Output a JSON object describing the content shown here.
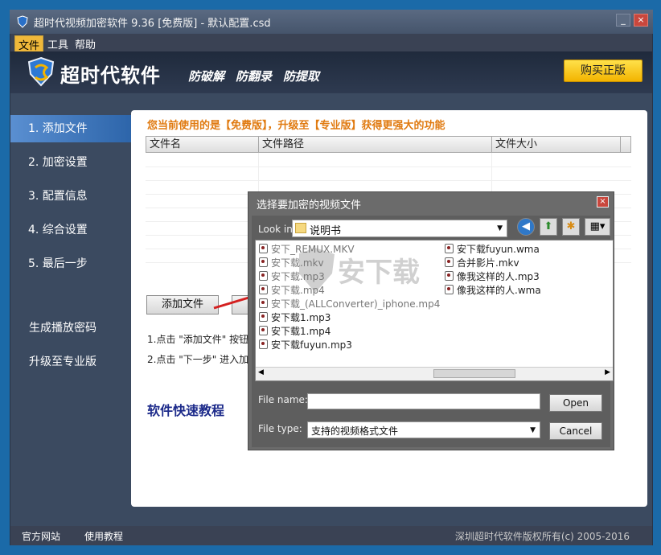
{
  "window": {
    "title": "超时代视频加密软件 9.36 [免费版] - 默认配置.csd",
    "minimize": "_",
    "close": "×"
  },
  "menu": [
    "文件",
    "工具",
    "帮助"
  ],
  "banner": {
    "brand": "超时代软件",
    "slogans": [
      "防破解",
      "防翻录",
      "防提取"
    ],
    "buy_label": "购买正版",
    "buy_color": "#f3b400"
  },
  "sidebar": {
    "steps": [
      "1. 添加文件",
      "2. 加密设置",
      "3. 配置信息",
      "4. 综合设置",
      "5. 最后一步"
    ],
    "active_index": 0,
    "extra": [
      "生成播放密码",
      "升级至专业版"
    ]
  },
  "content": {
    "notice": "您当前使用的是【免费版】，升级至【专业版】获得更强大的功能",
    "columns": [
      "文件名",
      "文件路径",
      "文件大小"
    ],
    "add_file_label": "添加文件",
    "hint1": "1.点击 \"添加文件\" 按钮选",
    "hint2": "2.点击 \"下一步\" 进入加密",
    "tutorial_title": "软件快速教程"
  },
  "statusbar": {
    "left": [
      "官方网站",
      "使用教程"
    ],
    "copyright": "深圳超时代软件版权所有(c) 2005-2016"
  },
  "dialog": {
    "title": "选择要加密的视频文件",
    "close": "×",
    "look_in_label": "Look in:",
    "look_in_value": "说明书",
    "files_col1": [
      "安下_REMUX.MKV",
      "安下载.mkv",
      "安下载.mp3",
      "安下载.mp4",
      "安下载_(ALLConverter)_iphone.mp4",
      "安下载1.mp3",
      "安下载1.mp4",
      "安下载fuyun.mp3"
    ],
    "files_col2": [
      "安下载fuyun.wma",
      "合并影片.mkv",
      "像我这样的人.mp3",
      "像我这样的人.wma"
    ],
    "file_name_label": "File name:",
    "file_name_value": "",
    "file_type_label": "File type:",
    "file_type_value": "支持的视频格式文件",
    "open_label": "Open",
    "cancel_label": "Cancel"
  },
  "watermark": "安下载"
}
